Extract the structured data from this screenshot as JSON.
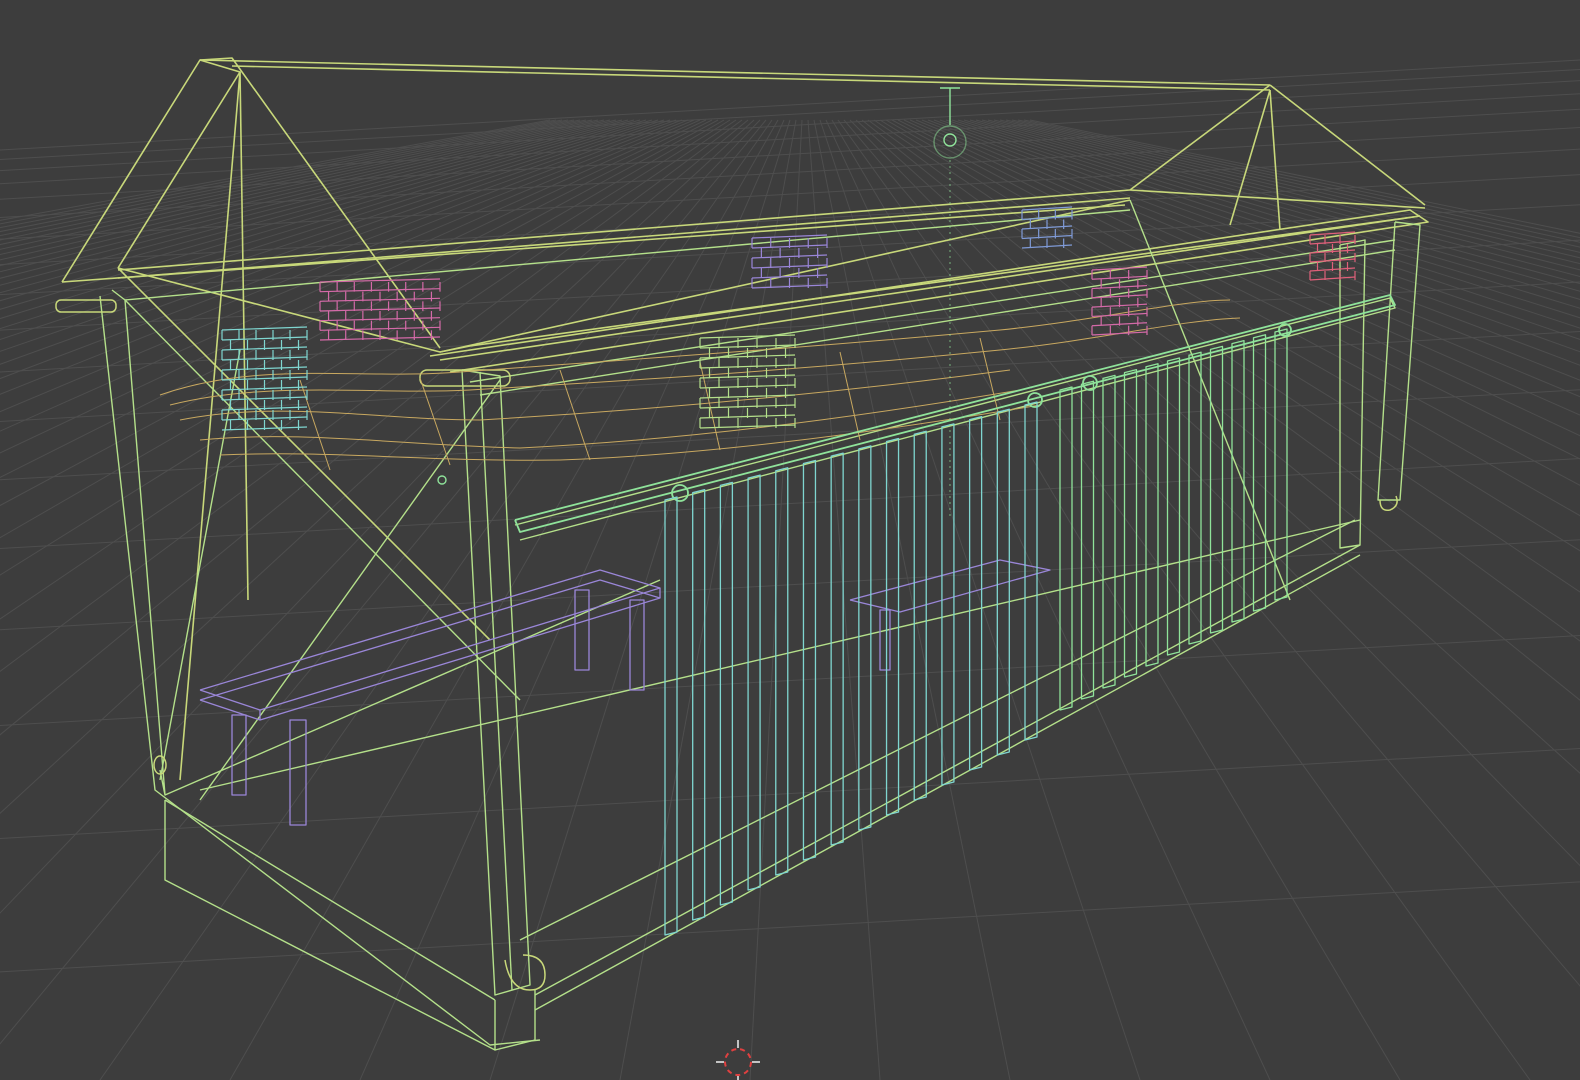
{
  "app": {
    "view": "3d-viewport",
    "shading_mode": "wireframe"
  },
  "colors": {
    "background": "#3d3d3d",
    "grid": "#4e4e4e",
    "wire_yellow": "#c8d87a",
    "wire_green": "#8fe39a",
    "wire_cyan": "#7fd6d0",
    "wire_lime": "#b4e08a",
    "wire_purple": "#9a86d8",
    "wire_pink": "#d46aa8",
    "wire_red": "#e0607a",
    "wire_blue": "#7f9ad6",
    "wire_ochre": "#c8a860",
    "cursor_red": "#e04040",
    "cursor_white": "#f0f0f0"
  },
  "scene": {
    "objects": [
      {
        "name": "roof-frame",
        "color_key": "wire_yellow"
      },
      {
        "name": "walls",
        "color_key": "wire_lime"
      },
      {
        "name": "sliding-door-left",
        "color_key": "wire_cyan"
      },
      {
        "name": "sliding-door-right",
        "color_key": "wire_green"
      },
      {
        "name": "bench",
        "color_key": "wire_purple"
      },
      {
        "name": "brick-panels",
        "color_key": "wire_pink"
      },
      {
        "name": "roof-insulation",
        "color_key": "wire_ochre"
      },
      {
        "name": "light-fixture",
        "color_key": "wire_green"
      },
      {
        "name": "door-rail",
        "color_key": "wire_green"
      },
      {
        "name": "gutters",
        "color_key": "wire_yellow"
      }
    ]
  },
  "icons": {
    "cursor": "3d-cursor-icon",
    "light": "light-fixture-icon"
  }
}
